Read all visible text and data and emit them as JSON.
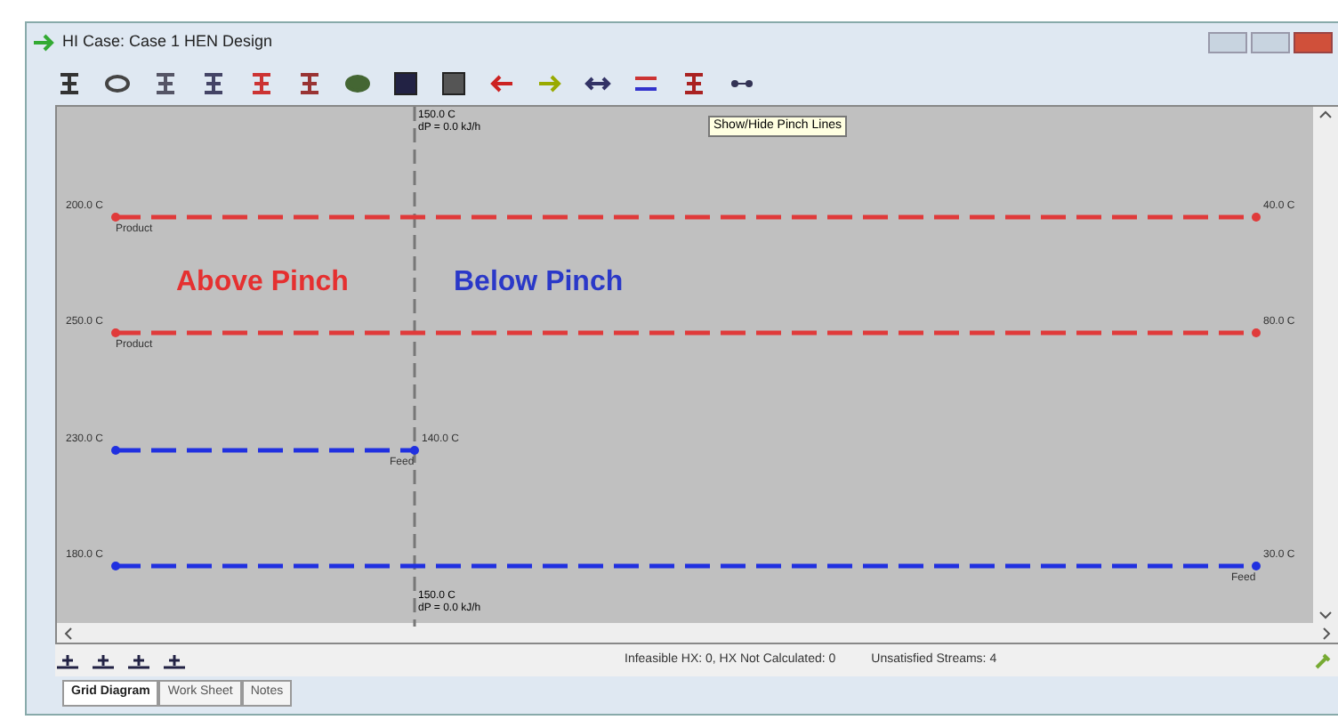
{
  "window": {
    "title": "HI Case: Case 1 HEN Design"
  },
  "tooltip": "Show/Hide Pinch Lines",
  "pinch": {
    "top_temp": "150.0 C",
    "top_duty": "dP = 0.0 kJ/h",
    "bottom_temp": "150.0 C",
    "bottom_duty": "dP = 0.0 kJ/h"
  },
  "regions": [
    {
      "kind": "above",
      "label": "Above Pinch"
    },
    {
      "kind": "below",
      "label": "Below Pinch"
    }
  ],
  "streams": [
    {
      "kind": "hot",
      "ends_at_pinch": false,
      "name": "Product",
      "left_temp": "200.0 C",
      "right_temp": "40.0 C"
    },
    {
      "kind": "hot",
      "ends_at_pinch": false,
      "name": "Product",
      "left_temp": "250.0 C",
      "right_temp": "80.0 C"
    },
    {
      "kind": "cold",
      "ends_at_pinch": true,
      "name": "Feed",
      "left_temp": "230.0 C",
      "right_temp": "140.0 C"
    },
    {
      "kind": "cold",
      "ends_at_pinch": false,
      "name": "Feed",
      "left_temp": "180.0 C",
      "right_temp": "30.0 C"
    }
  ],
  "status": [
    "Infeasible HX: 0, HX Not Calculated: 0",
    "Unsatisfied Streams: 4"
  ],
  "tabs": [
    {
      "label": "Grid Diagram",
      "selected": true
    },
    {
      "label": "Work Sheet",
      "selected": false
    },
    {
      "label": "Notes",
      "selected": false
    }
  ]
}
